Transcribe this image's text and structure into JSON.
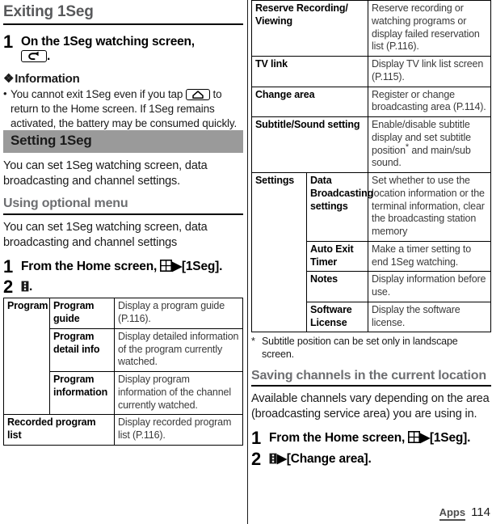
{
  "left": {
    "heading_exiting": "Exiting 1Seg",
    "step1": {
      "num": "1",
      "text_before": "On the 1Seg watching screen,",
      "icon": "back-key-icon",
      "text_after": "."
    },
    "information": {
      "title": "Information",
      "bullet_parts": {
        "part1": "You cannot exit 1Seg even if you tap",
        "icon": "home-key-icon",
        "part2": "to return to the Home screen. If 1Seg remains activated, the battery may be consumed quickly."
      }
    },
    "heading_setting": "Setting 1Seg",
    "para_setting": "You can set 1Seg watching screen, data broadcasting and channel settings.",
    "heading_optional_menu": "Using optional menu",
    "para_optional_menu": "You can set 1Seg watching screen, data broadcasting and channel settings",
    "step_home": {
      "num": "1",
      "text_before": "From the Home screen,",
      "icon": "apps-grid-icon",
      "arrow": "▶",
      "text_after": "[1Seg]."
    },
    "step_menu": {
      "num": "2",
      "icon": "overflow-menu-icon",
      "text_after": "."
    },
    "table_rows": [
      {
        "group": "Program",
        "key": "Program guide",
        "desc": "Display a program guide (P.116)."
      },
      {
        "group": "",
        "key": "Program detail info",
        "desc": "Display detailed information of the program currently watched."
      },
      {
        "group": "",
        "key": "Program information",
        "desc": "Display program information of the channel currently watched."
      },
      {
        "group": "Recorded program list",
        "key": "",
        "desc": "Display recorded program list (P.116)."
      }
    ]
  },
  "right": {
    "table_rows": [
      {
        "group": "Reserve Recording/ Viewing",
        "key": "",
        "desc": "Reserve recording or watching programs or display failed reservation list (P.116)."
      },
      {
        "group": "TV link",
        "key": "",
        "desc": "Display TV link list screen (P.115)."
      },
      {
        "group": "Change area",
        "key": "",
        "desc": "Register or change broadcasting area (P.114)."
      },
      {
        "group": "Subtitle/Sound setting",
        "key": "",
        "desc_pre": "Enable/disable subtitle display and set subtitle position",
        "desc_ast": "*",
        "desc_post": " and main/sub sound."
      },
      {
        "group": "Settings",
        "key": "Data Broadcasting settings",
        "desc": "Set whether to use the location information or the terminal information, clear the broadcasting station memory"
      },
      {
        "group": "",
        "key": "Auto Exit Timer",
        "desc": "Make a timer setting to end 1Seg watching."
      },
      {
        "group": "",
        "key": "Notes",
        "desc": "Display information before use."
      },
      {
        "group": "",
        "key": "Software License",
        "desc": "Display the software license."
      }
    ],
    "footnote": {
      "mark": "*",
      "text": "Subtitle position can be set only in landscape screen."
    },
    "heading_saving": "Saving channels in the current location",
    "para_saving": "Available channels vary depending on the area (broadcasting service area) you are using in.",
    "step_home": {
      "num": "1",
      "text_before": "From the Home screen,",
      "icon": "apps-grid-icon",
      "arrow": "▶",
      "text_after": "[1Seg]."
    },
    "step_change": {
      "num": "2",
      "icon": "overflow-menu-icon",
      "arrow": "▶",
      "text_after": "[Change area]."
    }
  },
  "footer": {
    "section": "Apps",
    "page": "114"
  }
}
